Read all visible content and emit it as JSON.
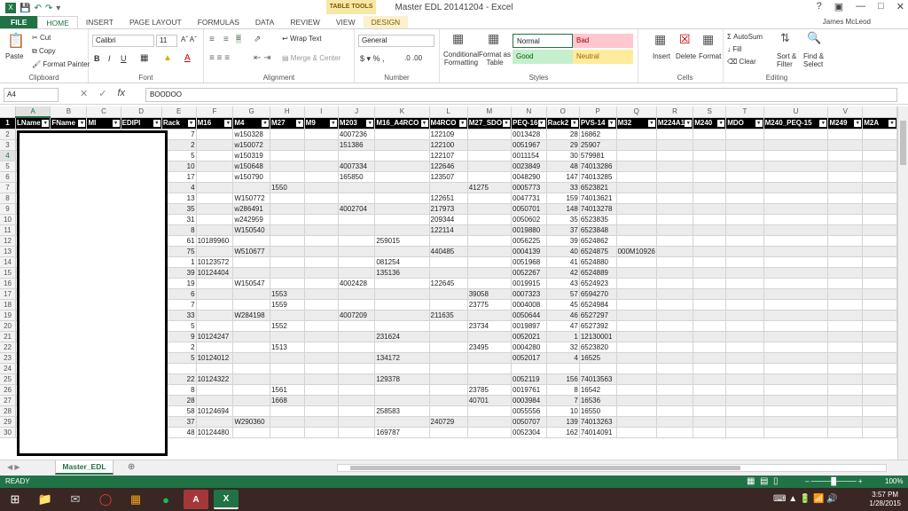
{
  "window": {
    "title": "Master EDL 20141204 - Excel",
    "contextual_tab_group": "TABLE TOOLS",
    "user": "James McLeod"
  },
  "ribbon_tabs": [
    "FILE",
    "HOME",
    "INSERT",
    "PAGE LAYOUT",
    "FORMULAS",
    "DATA",
    "REVIEW",
    "VIEW",
    "DESIGN"
  ],
  "ribbon": {
    "clipboard": {
      "paste": "Paste",
      "cut": "Cut",
      "copy": "Copy",
      "format_painter": "Format Painter",
      "label": "Clipboard"
    },
    "font": {
      "name": "Calibri",
      "size": "11",
      "label": "Font"
    },
    "alignment": {
      "wrap": "Wrap Text",
      "merge": "Merge & Center",
      "label": "Alignment"
    },
    "number": {
      "format": "General",
      "label": "Number"
    },
    "styles": {
      "conditional": "Conditional Formatting",
      "format_as_table": "Format as Table",
      "normal": "Normal",
      "bad": "Bad",
      "good": "Good",
      "neutral": "Neutral",
      "label": "Styles"
    },
    "cells": {
      "insert": "Insert",
      "delete": "Delete",
      "format": "Format",
      "label": "Cells"
    },
    "editing": {
      "autosum": "AutoSum",
      "fill": "Fill",
      "clear": "Clear",
      "sort": "Sort & Filter",
      "find": "Find & Select",
      "label": "Editing"
    }
  },
  "formula_bar": {
    "name_box": "A4",
    "content": "BOODOO"
  },
  "columns": [
    "A",
    "B",
    "C",
    "D",
    "E",
    "F",
    "G",
    "H",
    "I",
    "J",
    "K",
    "L",
    "M",
    "N",
    "O",
    "P",
    "Q",
    "R",
    "S",
    "T",
    "U",
    "V",
    ""
  ],
  "headers": [
    "LName",
    "FName",
    "MI",
    "EDIPI",
    "Rack",
    "M16",
    "M4",
    "M27",
    "M9",
    "M203",
    "M16_A4RCO",
    "M4RCO",
    "M27_SDO",
    "PEQ-16",
    "Rack2",
    "PVS-14",
    "M32",
    "M224A1",
    "M240",
    "MDO",
    "M240_PEQ-15",
    "M249",
    "M2A"
  ],
  "rows": [
    {
      "n": "2",
      "v": [
        "",
        "",
        "",
        "",
        "7",
        "",
        "w150328",
        "",
        "",
        "4007236",
        "",
        "122109",
        "",
        "0013428",
        "28",
        "16862",
        "",
        "",
        "",
        "",
        "",
        "",
        ""
      ]
    },
    {
      "n": "3",
      "v": [
        "",
        "",
        "",
        "",
        "2",
        "",
        "w150072",
        "",
        "",
        "151386",
        "",
        "122100",
        "",
        "0051967",
        "29",
        "25907",
        "",
        "",
        "",
        "",
        "",
        "",
        ""
      ]
    },
    {
      "n": "4",
      "v": [
        "",
        "",
        "",
        "",
        "5",
        "",
        "w150319",
        "",
        "",
        "",
        "",
        "122107",
        "",
        "0011154",
        "30",
        "579981",
        "",
        "",
        "",
        "",
        "",
        "",
        ""
      ]
    },
    {
      "n": "5",
      "v": [
        "",
        "",
        "",
        "",
        "10",
        "",
        "w150648",
        "",
        "",
        "4007334",
        "",
        "122646",
        "",
        "0023849",
        "48",
        "74013286",
        "",
        "",
        "",
        "",
        "",
        "",
        ""
      ]
    },
    {
      "n": "6",
      "v": [
        "",
        "",
        "",
        "",
        "17",
        "",
        "w150790",
        "",
        "",
        "165850",
        "",
        "123507",
        "",
        "0048290",
        "147",
        "74013285",
        "",
        "",
        "",
        "",
        "",
        "",
        ""
      ]
    },
    {
      "n": "7",
      "v": [
        "",
        "",
        "",
        "",
        "4",
        "",
        "",
        "1550",
        "",
        "",
        "",
        "",
        "41275",
        "0005773",
        "33",
        "6523821",
        "",
        "",
        "",
        "",
        "",
        "",
        ""
      ]
    },
    {
      "n": "8",
      "v": [
        "",
        "",
        "",
        "",
        "13",
        "",
        "W150772",
        "",
        "",
        "",
        "",
        "122651",
        "",
        "0047731",
        "159",
        "74013621",
        "",
        "",
        "",
        "",
        "",
        "",
        ""
      ]
    },
    {
      "n": "9",
      "v": [
        "",
        "",
        "",
        "",
        "35",
        "",
        "w286491",
        "",
        "",
        "4002704",
        "",
        "217973",
        "",
        "0050701",
        "148",
        "74013278",
        "",
        "",
        "",
        "",
        "",
        "",
        ""
      ]
    },
    {
      "n": "10",
      "v": [
        "",
        "",
        "",
        "",
        "31",
        "",
        "w242959",
        "",
        "",
        "",
        "",
        "209344",
        "",
        "0050602",
        "35",
        "6523835",
        "",
        "",
        "",
        "",
        "",
        "",
        ""
      ]
    },
    {
      "n": "11",
      "v": [
        "",
        "",
        "",
        "",
        "8",
        "",
        "W150540",
        "",
        "",
        "",
        "",
        "122114",
        "",
        "0019880",
        "37",
        "6523848",
        "",
        "",
        "",
        "",
        "",
        "",
        ""
      ]
    },
    {
      "n": "12",
      "v": [
        "",
        "",
        "",
        "",
        "61",
        "10189960",
        "",
        "",
        "",
        "",
        "259015",
        "",
        "",
        "0056225",
        "39",
        "6524862",
        "",
        "",
        "",
        "",
        "",
        "",
        ""
      ]
    },
    {
      "n": "13",
      "v": [
        "",
        "",
        "",
        "",
        "75",
        "",
        "W510677",
        "",
        "",
        "",
        "",
        "440485",
        "",
        "0004139",
        "40",
        "6524875",
        "000M10926",
        "",
        "",
        "",
        "",
        "",
        ""
      ]
    },
    {
      "n": "14",
      "v": [
        "",
        "",
        "",
        "",
        "1",
        "10123572",
        "",
        "",
        "",
        "",
        "081254",
        "",
        "",
        "0051968",
        "41",
        "6524880",
        "",
        "",
        "",
        "",
        "",
        "",
        ""
      ]
    },
    {
      "n": "15",
      "v": [
        "",
        "",
        "",
        "",
        "39",
        "10124404",
        "",
        "",
        "",
        "",
        "135136",
        "",
        "",
        "0052267",
        "42",
        "6524889",
        "",
        "",
        "",
        "",
        "",
        "",
        ""
      ]
    },
    {
      "n": "16",
      "v": [
        "",
        "",
        "",
        "",
        "19",
        "",
        "W150547",
        "",
        "",
        "4002428",
        "",
        "122645",
        "",
        "0019915",
        "43",
        "6524923",
        "",
        "",
        "",
        "",
        "",
        "",
        ""
      ]
    },
    {
      "n": "17",
      "v": [
        "",
        "",
        "",
        "",
        "6",
        "",
        "",
        "1553",
        "",
        "",
        "",
        "",
        "39058",
        "0007323",
        "57",
        "6594270",
        "",
        "",
        "",
        "",
        "",
        "",
        ""
      ]
    },
    {
      "n": "18",
      "v": [
        "",
        "",
        "",
        "",
        "7",
        "",
        "",
        "1559",
        "",
        "",
        "",
        "",
        "23775",
        "0004008",
        "45",
        "6524984",
        "",
        "",
        "",
        "",
        "",
        "",
        ""
      ]
    },
    {
      "n": "19",
      "v": [
        "",
        "",
        "",
        "",
        "33",
        "",
        "W284198",
        "",
        "",
        "4007209",
        "",
        "211635",
        "",
        "0050644",
        "46",
        "6527297",
        "",
        "",
        "",
        "",
        "",
        "",
        ""
      ]
    },
    {
      "n": "20",
      "v": [
        "",
        "",
        "",
        "",
        "5",
        "",
        "",
        "1552",
        "",
        "",
        "",
        "",
        "23734",
        "0019897",
        "47",
        "6527392",
        "",
        "",
        "",
        "",
        "",
        "",
        ""
      ]
    },
    {
      "n": "21",
      "v": [
        "",
        "",
        "",
        "",
        "9",
        "10124247",
        "",
        "",
        "",
        "",
        "231624",
        "",
        "",
        "0052021",
        "1",
        "12130001",
        "",
        "",
        "",
        "",
        "",
        "",
        ""
      ]
    },
    {
      "n": "22",
      "v": [
        "",
        "",
        "",
        "",
        "2",
        "",
        "",
        "1513",
        "",
        "",
        "",
        "",
        "23495",
        "0004280",
        "32",
        "6523820",
        "",
        "",
        "",
        "",
        "",
        "",
        ""
      ]
    },
    {
      "n": "23",
      "v": [
        "",
        "",
        "",
        "",
        "5",
        "10124012",
        "",
        "",
        "",
        "",
        "134172",
        "",
        "",
        "0052017",
        "4",
        "16525",
        "",
        "",
        "",
        "",
        "",
        "",
        ""
      ]
    },
    {
      "n": "24",
      "v": [
        "",
        "",
        "",
        "",
        "",
        "",
        "",
        "",
        "",
        "",
        "",
        "",
        "",
        "",
        "",
        "",
        "",
        "",
        "",
        "",
        "",
        "",
        ""
      ]
    },
    {
      "n": "25",
      "v": [
        "",
        "",
        "",
        "",
        "22",
        "10124322",
        "",
        "",
        "",
        "",
        "129378",
        "",
        "",
        "0052119",
        "156",
        "74013563",
        "",
        "",
        "",
        "",
        "",
        "",
        ""
      ]
    },
    {
      "n": "26",
      "v": [
        "",
        "",
        "",
        "",
        "8",
        "",
        "",
        "1561",
        "",
        "",
        "",
        "",
        "23785",
        "0019761",
        "8",
        "16542",
        "",
        "",
        "",
        "",
        "",
        "",
        ""
      ]
    },
    {
      "n": "27",
      "v": [
        "",
        "",
        "",
        "",
        "28",
        "",
        "",
        "1668",
        "",
        "",
        "",
        "",
        "40701",
        "0003984",
        "7",
        "16536",
        "",
        "",
        "",
        "",
        "",
        "",
        ""
      ]
    },
    {
      "n": "28",
      "v": [
        "",
        "",
        "",
        "",
        "58",
        "10124694",
        "",
        "",
        "",
        "",
        "258583",
        "",
        "",
        "0055556",
        "10",
        "16550",
        "",
        "",
        "",
        "",
        "",
        "",
        ""
      ]
    },
    {
      "n": "29",
      "v": [
        "",
        "",
        "",
        "",
        "37",
        "",
        "W290360",
        "",
        "",
        "",
        "",
        "240729",
        "",
        "0050707",
        "139",
        "74013263",
        "",
        "",
        "",
        "",
        "",
        "",
        ""
      ]
    },
    {
      "n": "30",
      "v": [
        "",
        "",
        "",
        "",
        "48",
        "10124480",
        "",
        "",
        "",
        "",
        "169787",
        "",
        "",
        "0052304",
        "162",
        "74014091",
        "",
        "",
        "",
        "",
        "",
        "",
        ""
      ]
    }
  ],
  "sheet_tab": "Master_EDL",
  "status": {
    "ready": "READY",
    "zoom": "100%"
  },
  "taskbar": {
    "time": "3:57 PM",
    "date": "1/28/2015"
  },
  "colors": {
    "excel_green": "#217346",
    "header_black": "#000000",
    "band": "#ececec"
  }
}
